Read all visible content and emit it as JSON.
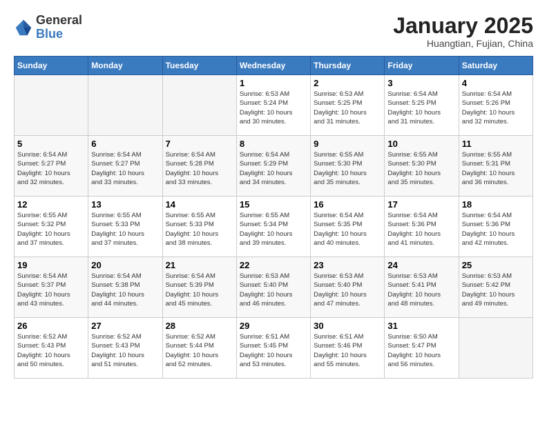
{
  "header": {
    "logo_general": "General",
    "logo_blue": "Blue",
    "month": "January 2025",
    "location": "Huangtian, Fujian, China"
  },
  "days_of_week": [
    "Sunday",
    "Monday",
    "Tuesday",
    "Wednesday",
    "Thursday",
    "Friday",
    "Saturday"
  ],
  "weeks": [
    [
      {
        "day": "",
        "info": ""
      },
      {
        "day": "",
        "info": ""
      },
      {
        "day": "",
        "info": ""
      },
      {
        "day": "1",
        "info": "Sunrise: 6:53 AM\nSunset: 5:24 PM\nDaylight: 10 hours\nand 30 minutes."
      },
      {
        "day": "2",
        "info": "Sunrise: 6:53 AM\nSunset: 5:25 PM\nDaylight: 10 hours\nand 31 minutes."
      },
      {
        "day": "3",
        "info": "Sunrise: 6:54 AM\nSunset: 5:25 PM\nDaylight: 10 hours\nand 31 minutes."
      },
      {
        "day": "4",
        "info": "Sunrise: 6:54 AM\nSunset: 5:26 PM\nDaylight: 10 hours\nand 32 minutes."
      }
    ],
    [
      {
        "day": "5",
        "info": "Sunrise: 6:54 AM\nSunset: 5:27 PM\nDaylight: 10 hours\nand 32 minutes."
      },
      {
        "day": "6",
        "info": "Sunrise: 6:54 AM\nSunset: 5:27 PM\nDaylight: 10 hours\nand 33 minutes."
      },
      {
        "day": "7",
        "info": "Sunrise: 6:54 AM\nSunset: 5:28 PM\nDaylight: 10 hours\nand 33 minutes."
      },
      {
        "day": "8",
        "info": "Sunrise: 6:54 AM\nSunset: 5:29 PM\nDaylight: 10 hours\nand 34 minutes."
      },
      {
        "day": "9",
        "info": "Sunrise: 6:55 AM\nSunset: 5:30 PM\nDaylight: 10 hours\nand 35 minutes."
      },
      {
        "day": "10",
        "info": "Sunrise: 6:55 AM\nSunset: 5:30 PM\nDaylight: 10 hours\nand 35 minutes."
      },
      {
        "day": "11",
        "info": "Sunrise: 6:55 AM\nSunset: 5:31 PM\nDaylight: 10 hours\nand 36 minutes."
      }
    ],
    [
      {
        "day": "12",
        "info": "Sunrise: 6:55 AM\nSunset: 5:32 PM\nDaylight: 10 hours\nand 37 minutes."
      },
      {
        "day": "13",
        "info": "Sunrise: 6:55 AM\nSunset: 5:33 PM\nDaylight: 10 hours\nand 37 minutes."
      },
      {
        "day": "14",
        "info": "Sunrise: 6:55 AM\nSunset: 5:33 PM\nDaylight: 10 hours\nand 38 minutes."
      },
      {
        "day": "15",
        "info": "Sunrise: 6:55 AM\nSunset: 5:34 PM\nDaylight: 10 hours\nand 39 minutes."
      },
      {
        "day": "16",
        "info": "Sunrise: 6:54 AM\nSunset: 5:35 PM\nDaylight: 10 hours\nand 40 minutes."
      },
      {
        "day": "17",
        "info": "Sunrise: 6:54 AM\nSunset: 5:36 PM\nDaylight: 10 hours\nand 41 minutes."
      },
      {
        "day": "18",
        "info": "Sunrise: 6:54 AM\nSunset: 5:36 PM\nDaylight: 10 hours\nand 42 minutes."
      }
    ],
    [
      {
        "day": "19",
        "info": "Sunrise: 6:54 AM\nSunset: 5:37 PM\nDaylight: 10 hours\nand 43 minutes."
      },
      {
        "day": "20",
        "info": "Sunrise: 6:54 AM\nSunset: 5:38 PM\nDaylight: 10 hours\nand 44 minutes."
      },
      {
        "day": "21",
        "info": "Sunrise: 6:54 AM\nSunset: 5:39 PM\nDaylight: 10 hours\nand 45 minutes."
      },
      {
        "day": "22",
        "info": "Sunrise: 6:53 AM\nSunset: 5:40 PM\nDaylight: 10 hours\nand 46 minutes."
      },
      {
        "day": "23",
        "info": "Sunrise: 6:53 AM\nSunset: 5:40 PM\nDaylight: 10 hours\nand 47 minutes."
      },
      {
        "day": "24",
        "info": "Sunrise: 6:53 AM\nSunset: 5:41 PM\nDaylight: 10 hours\nand 48 minutes."
      },
      {
        "day": "25",
        "info": "Sunrise: 6:53 AM\nSunset: 5:42 PM\nDaylight: 10 hours\nand 49 minutes."
      }
    ],
    [
      {
        "day": "26",
        "info": "Sunrise: 6:52 AM\nSunset: 5:43 PM\nDaylight: 10 hours\nand 50 minutes."
      },
      {
        "day": "27",
        "info": "Sunrise: 6:52 AM\nSunset: 5:43 PM\nDaylight: 10 hours\nand 51 minutes."
      },
      {
        "day": "28",
        "info": "Sunrise: 6:52 AM\nSunset: 5:44 PM\nDaylight: 10 hours\nand 52 minutes."
      },
      {
        "day": "29",
        "info": "Sunrise: 6:51 AM\nSunset: 5:45 PM\nDaylight: 10 hours\nand 53 minutes."
      },
      {
        "day": "30",
        "info": "Sunrise: 6:51 AM\nSunset: 5:46 PM\nDaylight: 10 hours\nand 55 minutes."
      },
      {
        "day": "31",
        "info": "Sunrise: 6:50 AM\nSunset: 5:47 PM\nDaylight: 10 hours\nand 56 minutes."
      },
      {
        "day": "",
        "info": ""
      }
    ]
  ]
}
